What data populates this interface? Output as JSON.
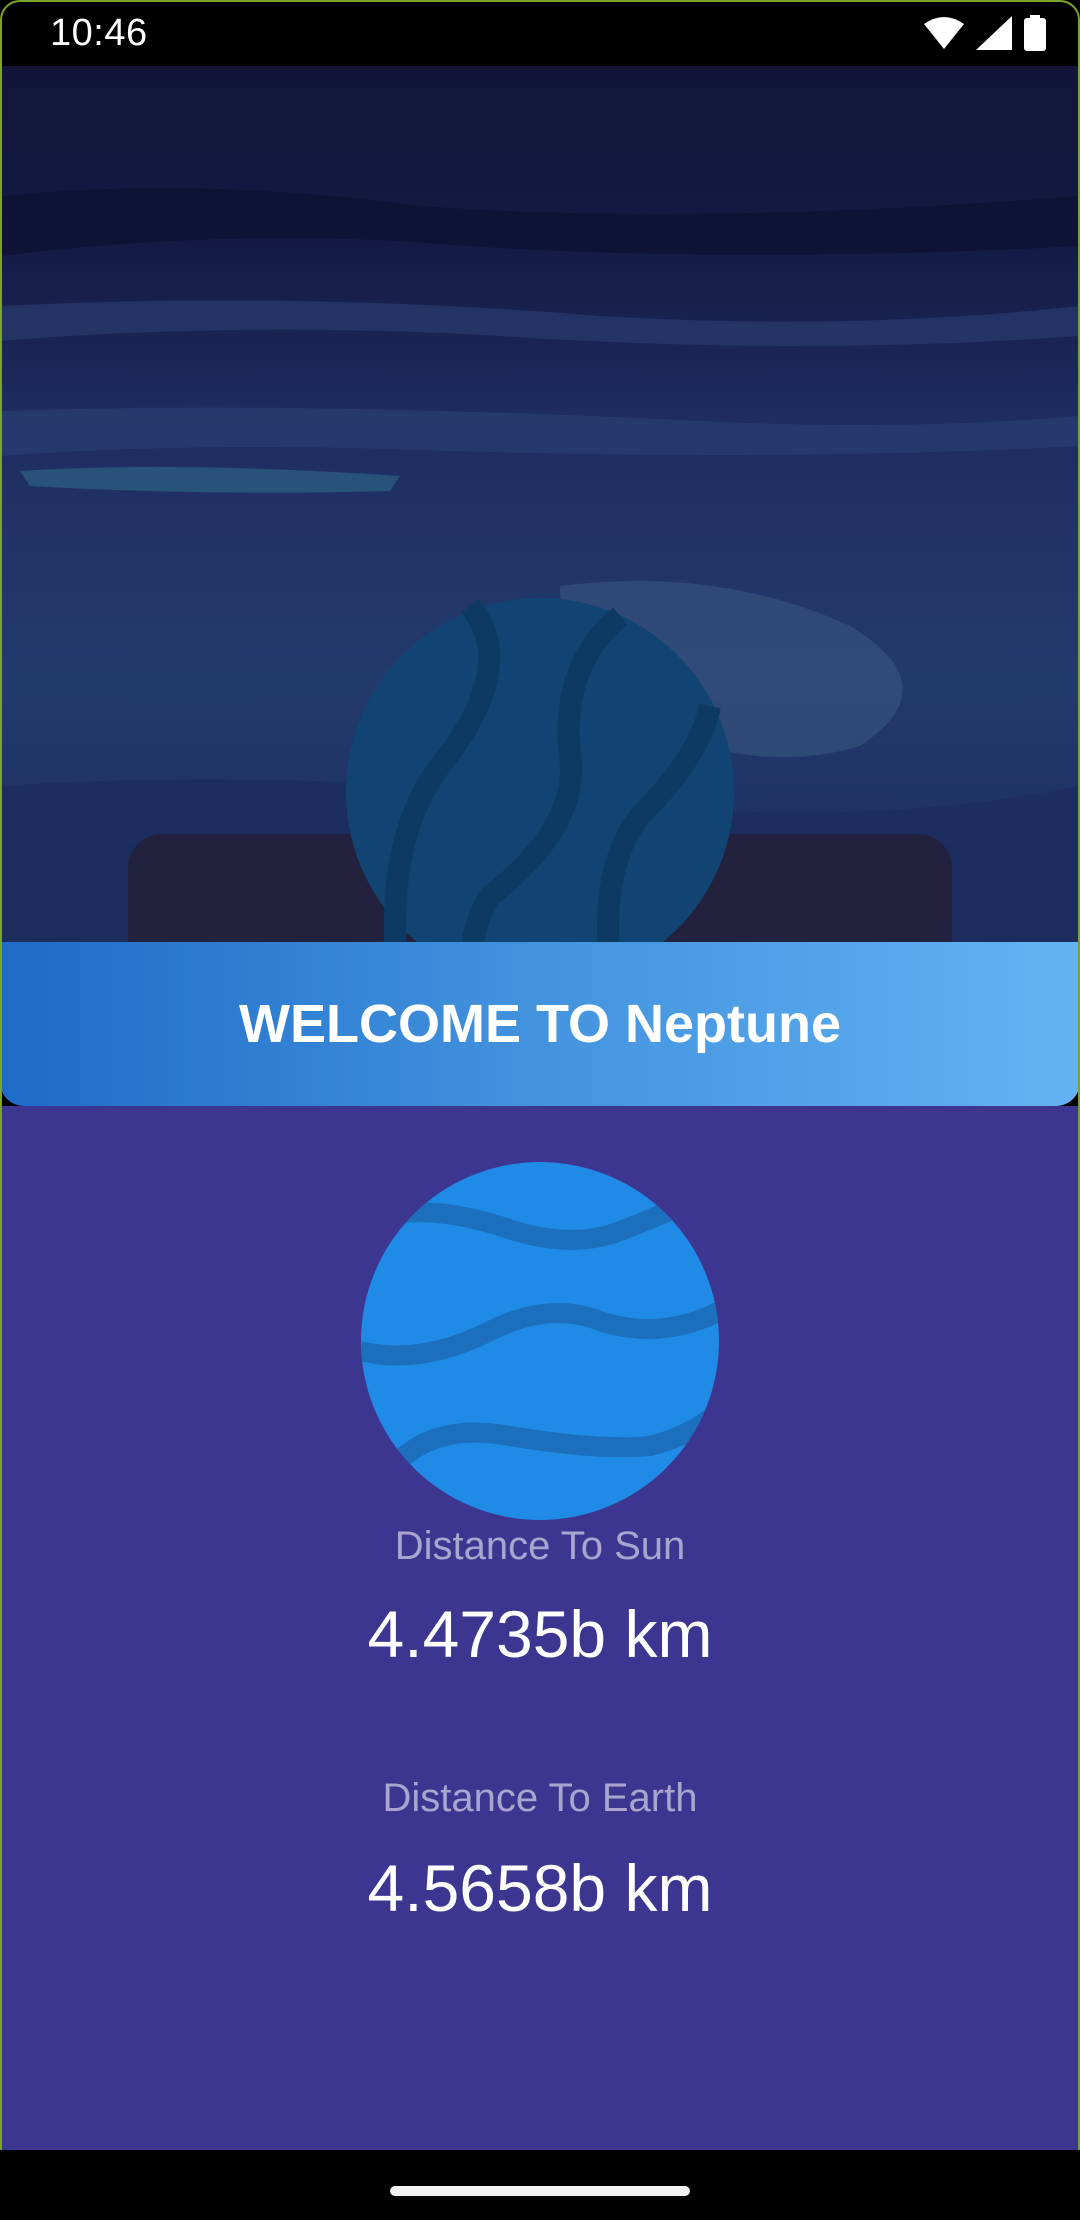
{
  "status_bar": {
    "time": "10:46",
    "icons": [
      "wifi-icon",
      "cellular-signal-icon",
      "battery-icon"
    ]
  },
  "banner": {
    "title": "WELCOME TO Neptune"
  },
  "stats": {
    "sun_label": "Distance To Sun",
    "sun_value": "4.4735b km",
    "earth_label": "Distance To Earth",
    "earth_value": "4.5658b km"
  },
  "colors": {
    "content_bg": "#3c3690",
    "banner_start": "#1e6bc8",
    "banner_end": "#64b3f4",
    "planet": "#1f8be6"
  }
}
